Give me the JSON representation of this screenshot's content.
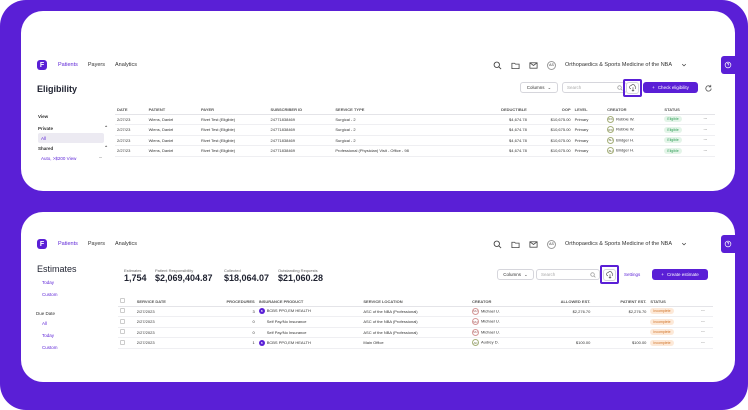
{
  "nav": {
    "logo": "F",
    "links": [
      "Patients",
      "Payers",
      "Analytics"
    ],
    "org_initials": "AS",
    "org_name": "Orthopaedics & Sports Medicine of the NBA"
  },
  "eligibility": {
    "title": "Eligibility",
    "sidebar": {
      "view_label": "View",
      "private_label": "Private",
      "private_items": [
        "All"
      ],
      "shared_label": "Shared",
      "shared_items": [
        "Auto, >$200 View"
      ]
    },
    "toolbar": {
      "columns_label": "Columns",
      "search_placeholder": "Search",
      "check_label": "Check eligibility"
    },
    "columns": [
      "DATE",
      "PATIENT",
      "PAYER",
      "SUBSCRIBER ID",
      "SERVICE TYPE",
      "DEDUCTIBLE",
      "OOP",
      "LEVEL",
      "CREATOR",
      "STATUS"
    ],
    "rows": [
      {
        "date": "2/27/23",
        "patient": "Wiens, Daniel",
        "payer": "Rivet Test (Eligible)",
        "subscriber_id": "24771838469",
        "service_type": "Surgical - 2",
        "deductible": "$4,674.78",
        "oop": "$10,675.00",
        "level": "Primary",
        "creator_initials": "RW",
        "creator": "Robbie W.",
        "status": "Eligible"
      },
      {
        "date": "2/27/23",
        "patient": "Wiens, Daniel",
        "payer": "Rivet Test (Eligible)",
        "subscriber_id": "24771838469",
        "service_type": "Surgical - 2",
        "deductible": "$4,674.78",
        "oop": "$10,675.00",
        "level": "Primary",
        "creator_initials": "RW",
        "creator": "Robbie W.",
        "status": "Eligible"
      },
      {
        "date": "2/27/23",
        "patient": "Wiens, Daniel",
        "payer": "Rivet Test (Eligible)",
        "subscriber_id": "24771838469",
        "service_type": "Surgical - 2",
        "deductible": "$4,674.78",
        "oop": "$10,675.00",
        "level": "Primary",
        "creator_initials": "BH",
        "creator": "Bridger H.",
        "status": "Eligible"
      },
      {
        "date": "2/27/23",
        "patient": "Wiens, Daniel",
        "payer": "Rivet Test (Eligible)",
        "subscriber_id": "24771838469",
        "service_type": "Professional (Physician) Visit - Office - 98",
        "deductible": "$4,674.78",
        "oop": "$10,675.00",
        "level": "Primary",
        "creator_initials": "BH",
        "creator": "Bridger H.",
        "status": "Eligible"
      }
    ]
  },
  "estimates": {
    "title": "Estimates",
    "sidebar": {
      "items": [
        "Today",
        "Custom"
      ],
      "due_label": "Due Date",
      "due_items": [
        "All",
        "Today",
        "Custom"
      ]
    },
    "stats": [
      {
        "label": "Estimates",
        "value": "1,754"
      },
      {
        "label": "Patient Responsibility",
        "value": "$2,069,404.87"
      },
      {
        "label": "Collected",
        "value": "$18,064.07"
      },
      {
        "label": "Outstanding Requests",
        "value": "$21,060.28"
      }
    ],
    "toolbar": {
      "columns_label": "Columns",
      "search_placeholder": "Search",
      "settings_label": "Settings",
      "create_label": "Create estimate"
    },
    "columns": [
      "SERVICE DATE",
      "PROCEDURES",
      "INSURANCE PRODUCT",
      "SERVICE LOCATION",
      "CREATOR",
      "ALLOWED EST.",
      "PATIENT EST.",
      "STATUS"
    ],
    "rows": [
      {
        "date": "2/27/2023",
        "procedures": "3",
        "plan_badge": "B",
        "product": "BCBS PPO,EM HEALTH",
        "location": "ASC of the NBA (Professional)",
        "creator_initials": "MU",
        "creator": "Michael U.",
        "allowed": "$2,276.70",
        "patient": "$2,276.70",
        "status": "Incomplete"
      },
      {
        "date": "2/27/2023",
        "procedures": "0",
        "plan_badge": "",
        "product": "Self Pay/No Insurance",
        "location": "ASC of the NBA (Professional)",
        "creator_initials": "MU",
        "creator": "Michael U.",
        "allowed": "",
        "patient": "",
        "status": "Incomplete"
      },
      {
        "date": "2/27/2023",
        "procedures": "0",
        "plan_badge": "",
        "product": "Self Pay/No Insurance",
        "location": "ASC of the NBA (Professional)",
        "creator_initials": "MU",
        "creator": "Michael U.",
        "allowed": "",
        "patient": "",
        "status": "Incomplete"
      },
      {
        "date": "2/27/2023",
        "procedures": "1",
        "plan_badge": "B",
        "product": "BCBS PPO,EM HEALTH",
        "location": "Main Office",
        "creator_initials": "AD",
        "creator": "Audrey D.",
        "allowed": "$100.00",
        "patient": "$100.00",
        "status": "Incomplete"
      }
    ]
  },
  "colors": {
    "brand": "#5a1fd6",
    "eligible": "#2f9d55",
    "incomplete": "#d07226"
  },
  "icons": [
    "search-icon",
    "folder-icon",
    "mail-icon",
    "chevron-down-icon",
    "help-icon",
    "download-icon",
    "refresh-icon",
    "plus-icon",
    "more-icon"
  ]
}
